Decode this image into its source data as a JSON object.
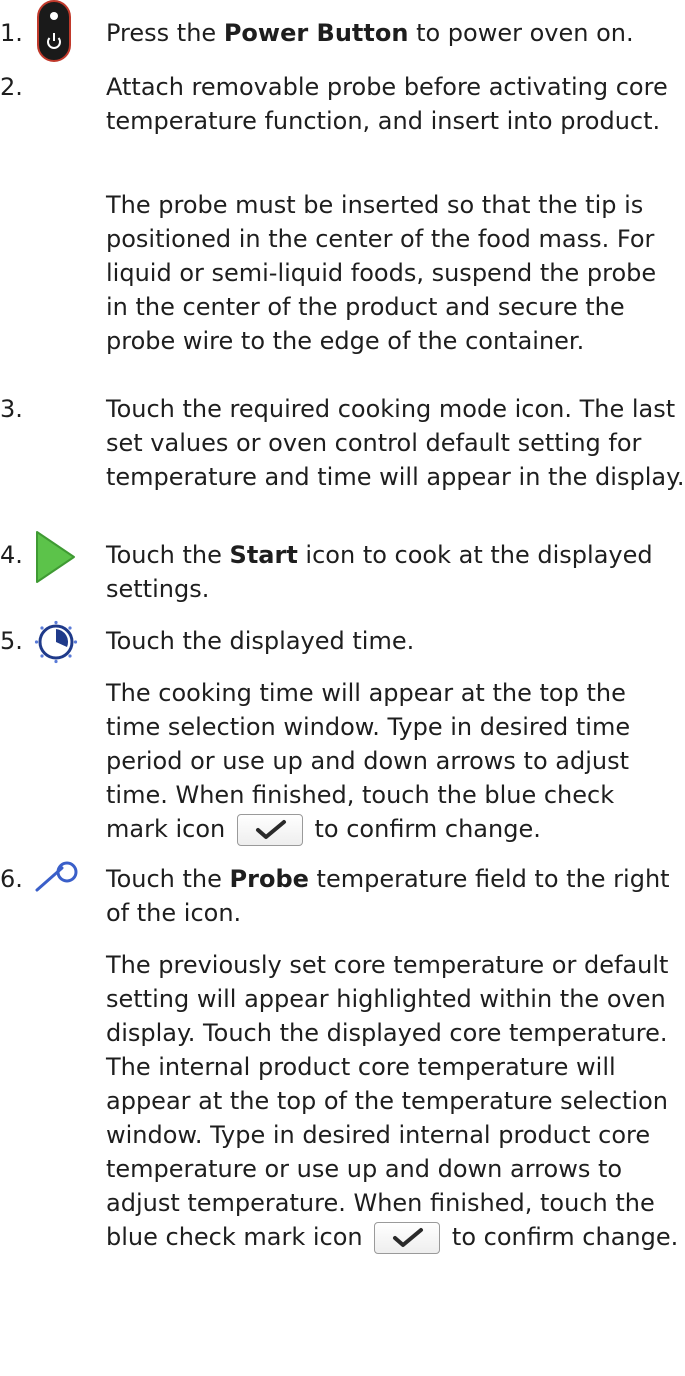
{
  "steps": [
    {
      "number": "1.",
      "icon": "power-button-icon",
      "before": "Press the ",
      "bold": "Power Button",
      "after": " to power oven on."
    },
    {
      "number": "2.",
      "text": "Attach removable probe before activating core temperature function, and insert into product.",
      "note": "The probe must be inserted so that the tip is positioned in the center of the food mass. For liquid or semi-liquid foods, suspend the probe in the center of the product and secure the probe wire to the edge of the container."
    },
    {
      "number": "3.",
      "text": "Touch the required cooking mode icon. The last set values or oven control default setting for temperature and time will appear in the display."
    },
    {
      "number": "4.",
      "icon": "start-play-icon",
      "before": "Touch the ",
      "bold": "Start",
      "after": " icon to cook at the displayed settings."
    },
    {
      "number": "5.",
      "icon": "timer-clock-icon",
      "text": "Touch the displayed time.",
      "note_before": "The cooking time will appear at the top the time selection window. Type in desired time period or use up and down arrows to adjust time. When finished, touch the blue check mark icon ",
      "note_after": " to confirm change."
    },
    {
      "number": "6.",
      "icon": "probe-icon",
      "before": "Touch the ",
      "bold": "Probe",
      "after": " temperature field to the right of the icon.",
      "note_before": "The previously set core temperature or default setting will appear highlighted within the oven display. Touch the displayed core temperature. The internal product core temperature will appear at the top of the temperature selection window. Type in desired internal product core temperature or use up and down arrows to adjust temperature. When finished, touch the blue check mark icon ",
      "note_after": " to confirm change."
    }
  ],
  "colors": {
    "text": "#1e1e1e",
    "power_bg": "#1a1a1a",
    "power_border": "#c0392b",
    "start_green": "#5cc34a",
    "timer_blue": "#1f3a8a",
    "probe_blue": "#3a5fc9"
  }
}
